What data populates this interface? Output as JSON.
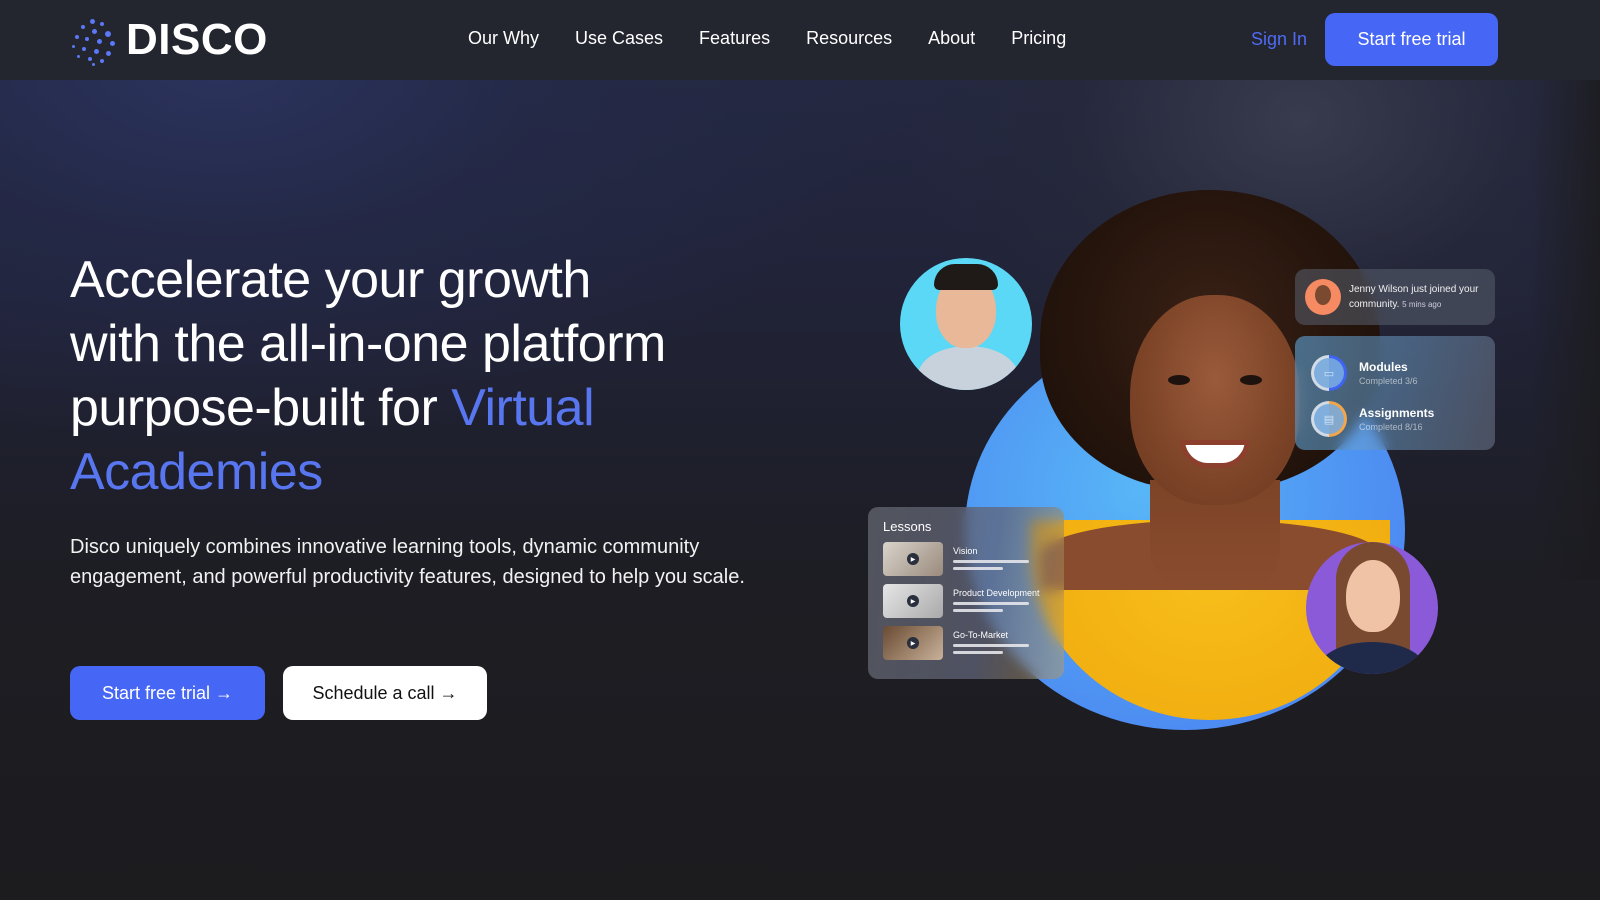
{
  "brand": {
    "name": "DISCO",
    "accent_color": "#4666f6",
    "highlight_color": "#5876ef"
  },
  "nav": {
    "links": [
      "Our Why",
      "Use Cases",
      "Features",
      "Resources",
      "About",
      "Pricing"
    ],
    "sign_in": "Sign In",
    "cta": "Start free trial"
  },
  "hero": {
    "headline_plain": "Accelerate your growth with the all-in-one platform purpose-built for ",
    "headline_line1": "Accelerate your growth",
    "headline_line2": "with the all-in-one platform",
    "headline_line3": "purpose-built for ",
    "headline_accent_1": "Virtual",
    "headline_accent_2": "Academies",
    "subtext": "Disco uniquely combines innovative learning tools, dynamic community engagement, and powerful productivity features, designed to help you scale.",
    "primary_cta": "Start free trial →",
    "secondary_cta": "Schedule a call →"
  },
  "illustration": {
    "notification": {
      "name": "Jenny Wilson",
      "message": "just joined your community.",
      "time": "5 mins ago"
    },
    "progress": [
      {
        "title": "Modules",
        "subtitle": "Completed 3/6",
        "completed": 3,
        "total": 6,
        "color": "#3f63f3",
        "icon": "folder-icon"
      },
      {
        "title": "Assignments",
        "subtitle": "Completed 8/16",
        "completed": 8,
        "total": 16,
        "color": "#f2a54a",
        "icon": "clipboard-icon"
      }
    ],
    "lessons": {
      "title": "Lessons",
      "items": [
        "Vision",
        "Product Development",
        "Go-To-Market"
      ]
    }
  }
}
